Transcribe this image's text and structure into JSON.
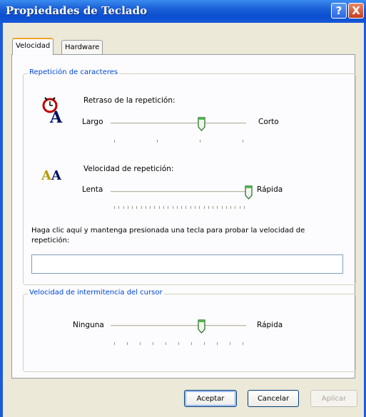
{
  "window": {
    "title": "Propiedades de Teclado",
    "help_glyph": "?",
    "close_glyph": "X"
  },
  "tabs": [
    {
      "label": "Velocidad",
      "active": true
    },
    {
      "label": "Hardware",
      "active": false
    }
  ],
  "repeat_group": {
    "label": "Repetición de caracteres",
    "delay": {
      "title": "Retraso de la repetición:",
      "min_label": "Largo",
      "max_label": "Corto",
      "value_fraction": 0.67
    },
    "rate": {
      "title": "Velocidad de repetición:",
      "min_label": "Lenta",
      "max_label": "Rápida",
      "value_fraction": 1.0
    },
    "test_prompt": "Haga clic aquí y mantenga presionada una tecla para probar la velocidad de repetición:",
    "test_value": ""
  },
  "cursor_group": {
    "label": "Velocidad de intermitencia del cursor",
    "min_label": "Ninguna",
    "max_label": "Rápida",
    "value_fraction": 0.67
  },
  "buttons": {
    "accept": "Aceptar",
    "cancel": "Cancelar",
    "apply": "Aplicar"
  },
  "icons": {
    "delay_icon": "clock-letter-a-icon",
    "rate_icon": "double-letter-a-icon"
  },
  "colors": {
    "titlebar": "#0a4fd0",
    "group_label": "#0046d5",
    "tab_highlight": "#f0a528"
  }
}
